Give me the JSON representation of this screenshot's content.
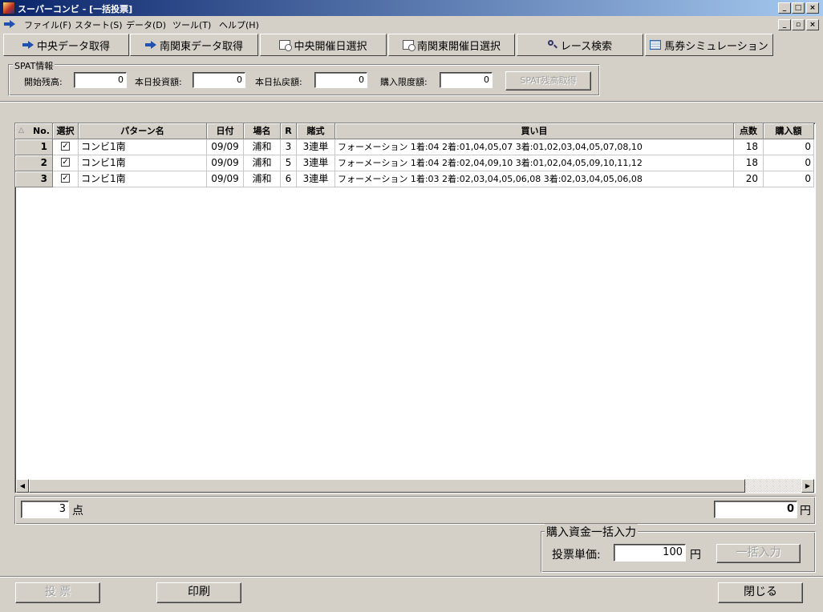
{
  "window": {
    "title": "スーパーコンビ - [一括投票]",
    "menus": [
      "ファイル(F)",
      "スタート(S)",
      "データ(D)",
      "ツール(T)",
      "ヘルプ(H)"
    ]
  },
  "toolbar": {
    "buttons": [
      "中央データ取得",
      "南関東データ取得",
      "中央開催日選択",
      "南関東開催日選択",
      "レース検索",
      "馬券シミュレーション"
    ]
  },
  "spat": {
    "label": "SPAT情報",
    "start_balance_label": "開始残高:",
    "start_balance": "0",
    "today_invest_label": "本日投資額:",
    "today_invest": "0",
    "today_refund_label": "本日払戻額:",
    "today_refund": "0",
    "purchase_limit_label": "購入限度額:",
    "purchase_limit": "0",
    "fetch_button": "SPAT残高取得"
  },
  "grid": {
    "sort_indicator": "△",
    "headers": [
      "No.",
      "選択",
      "パターン名",
      "日付",
      "場名",
      "R",
      "賭式",
      "買い目",
      "点数",
      "購入額"
    ],
    "rows": [
      {
        "no": "1",
        "checked": "✓",
        "pattern": "コンビ1南",
        "date": "09/09",
        "venue": "浦和",
        "race": "3",
        "bet_type": "3連単",
        "selection": "フォーメーション 1着:04 2着:01,04,05,07 3着:01,02,03,04,05,07,08,10",
        "points": "18",
        "amount": "0"
      },
      {
        "no": "2",
        "checked": "✓",
        "pattern": "コンビ1南",
        "date": "09/09",
        "venue": "浦和",
        "race": "5",
        "bet_type": "3連単",
        "selection": "フォーメーション 1着:04 2着:02,04,09,10 3着:01,02,04,05,09,10,11,12",
        "points": "18",
        "amount": "0"
      },
      {
        "no": "3",
        "checked": "✓",
        "pattern": "コンビ1南",
        "date": "09/09",
        "venue": "浦和",
        "race": "6",
        "bet_type": "3連単",
        "selection": "フォーメーション 1着:03 2着:02,03,04,05,06,08 3着:02,03,04,05,06,08",
        "points": "20",
        "amount": "0"
      }
    ]
  },
  "summary": {
    "points_total": "3",
    "points_unit": "点",
    "amount_total": "0",
    "amount_unit": "円"
  },
  "bulk": {
    "label": "購入資金一括入力",
    "unit_price_label": "投票単価:",
    "unit_price": "100",
    "unit": "円",
    "apply_button": "一括入力"
  },
  "footer": {
    "vote_button": "投 票",
    "print_button": "印刷",
    "close_button": "閉じる"
  },
  "colors": {
    "face": "#d4d0c8",
    "title_start": "#0a246a",
    "title_end": "#a6caf0"
  }
}
